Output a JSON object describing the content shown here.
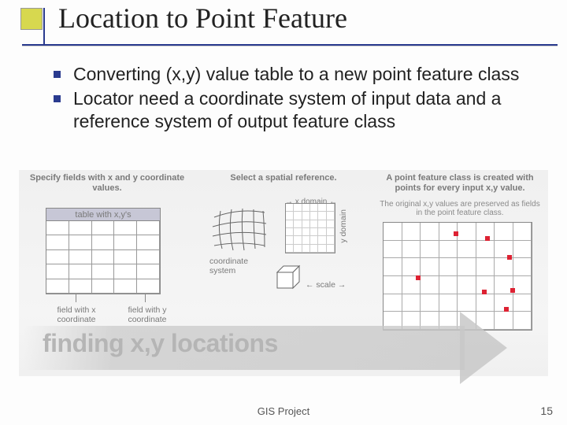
{
  "slide": {
    "title": "Location to Point Feature",
    "bullets": [
      "Converting (x,y) value table to a new point feature class",
      "Locator need a coordinate system of input data and a reference system of output feature class"
    ],
    "footer": "GIS Project",
    "page_number": "15"
  },
  "diagram": {
    "panel1": {
      "heading": "Specify fields with x and y coordinate values.",
      "table_caption": "table with x,y's",
      "left_field_label": "field with x coordinate",
      "right_field_label": "field with y coordinate"
    },
    "panel2": {
      "heading": "Select a spatial reference.",
      "coord_label": "coordinate system",
      "xdomain": "x domain",
      "ydomain": "y domain",
      "scale": "scale"
    },
    "panel3": {
      "heading": "A point feature class is created with points for every input x,y value.",
      "sub": "The original x,y values are preserved as fields in the point feature class."
    },
    "arrow_text": "finding x,y locations"
  }
}
